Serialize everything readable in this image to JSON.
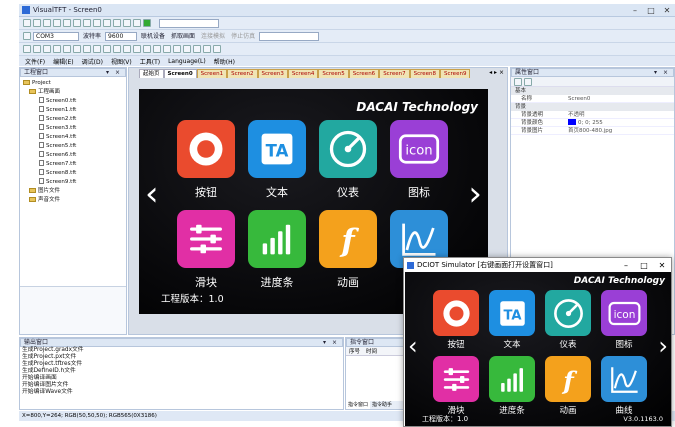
{
  "app": {
    "title": "VisualTFT - Screen0",
    "window_controls": [
      "–",
      "□",
      "✕"
    ]
  },
  "toolbar2": {
    "port": "COM3",
    "baud_label": "波特率",
    "baud": "9600",
    "connect": "联机设备",
    "screenshot": "抓取画面",
    "sim_connect": "连接模拟",
    "sim_stop": "停止仿真"
  },
  "menu": [
    "文件(F)",
    "编辑(E)",
    "调试(D)",
    "视图(V)",
    "工具(T)",
    "Language(L)",
    "帮助(H)"
  ],
  "project_panel": {
    "title": "工程窗口",
    "root": "Project",
    "group": "工程画面",
    "screens": [
      "Screen0.tft",
      "Screen1.tft",
      "Screen2.tft",
      "Screen3.tft",
      "Screen4.tft",
      "Screen5.tft",
      "Screen6.tft",
      "Screen7.tft",
      "Screen8.tft",
      "Screen9.tft"
    ],
    "folders": [
      "图片文件",
      "声音文件"
    ]
  },
  "editor_tabs": [
    "起始页",
    "Screen0",
    "Screen1",
    "Screen2",
    "Screen3",
    "Screen4",
    "Screen5",
    "Screen6",
    "Screen7",
    "Screen8",
    "Screen9"
  ],
  "design": {
    "brand": "DACAI Technology",
    "tiles": [
      {
        "label": "按钮",
        "icon": "record-button-icon",
        "color": "#ea4b2e"
      },
      {
        "label": "文本",
        "icon": "text-icon",
        "color": "#1e8fe1"
      },
      {
        "label": "仪表",
        "icon": "gauge-icon",
        "color": "#22a8a0"
      },
      {
        "label": "图标",
        "icon": "icon-text-icon",
        "color": "#9a3fd6"
      },
      {
        "label": "滑块",
        "icon": "slider-icon",
        "color": "#e12fa5"
      },
      {
        "label": "进度条",
        "icon": "progress-bars-icon",
        "color": "#37b93c"
      },
      {
        "label": "动画",
        "icon": "flash-icon",
        "color": "#f4a11c"
      },
      {
        "label": "曲线",
        "icon": "curve-icon",
        "color": "#2d8fd8"
      }
    ],
    "version": "工程版本：1.0",
    "icon_word": "icon",
    "text_glyph": "TA",
    "flash_glyph": "f",
    "left_arrow": "‹",
    "right_arrow": "›"
  },
  "property_panel": {
    "title": "属性窗口",
    "sections": [
      {
        "name": "基本",
        "rows": [
          {
            "k": "名称",
            "v": "Screen0"
          }
        ]
      },
      {
        "name": "背景",
        "rows": [
          {
            "k": "背景透明",
            "v": "不透明"
          },
          {
            "k": "背景颜色",
            "v": "0; 0; 255"
          },
          {
            "k": "背景图片",
            "v": "首页800-480.jpg"
          }
        ]
      }
    ],
    "bg_color": "#0000ff"
  },
  "output_panel": {
    "title": "输出窗口",
    "lines": [
      "生成Project.gradx文件",
      "生成Project.pxt文件",
      "生成Project.tftres文件",
      "生成DefineID.h文件",
      "开始编译画面",
      "开始编译图片文件",
      "开始编译Wave文件"
    ]
  },
  "command_panel": {
    "title": "指令窗口",
    "col1": "序号",
    "col2": "时间",
    "tab1": "指令窗口",
    "tab2": "指令助手"
  },
  "status": {
    "text": "X=800,Y=264; RGB(50,50,50); RGB565(0X3186)"
  },
  "simulator": {
    "title": "DCIOT Simulator [右键画面打开设置窗口]",
    "version": "V3.0.1163.0",
    "controls": [
      "–",
      "□",
      "✕"
    ]
  }
}
